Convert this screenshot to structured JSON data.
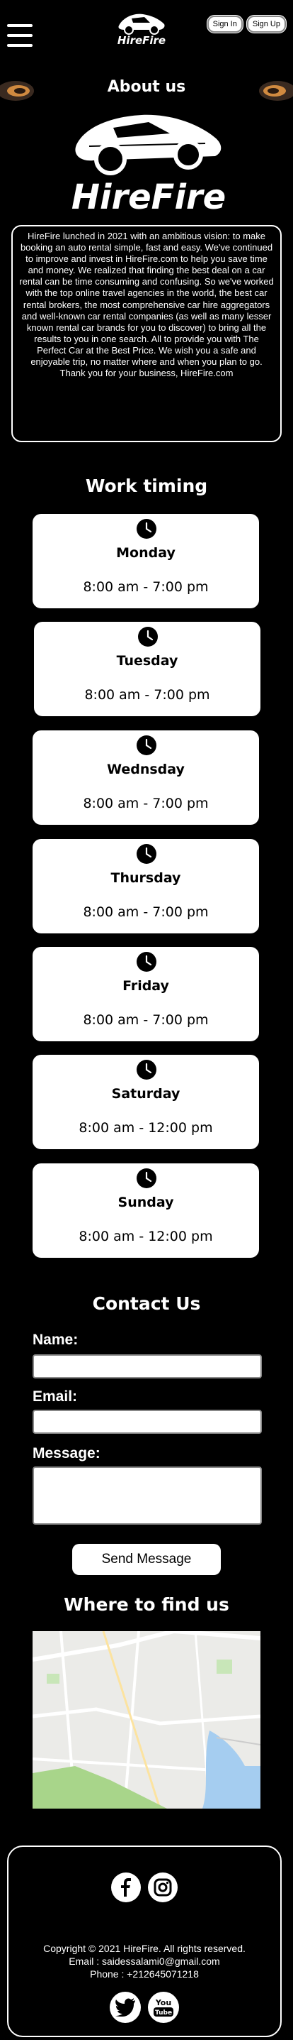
{
  "header": {
    "sign_in": "Sign In",
    "sign_up": "Sign Up"
  },
  "about": {
    "title": "About us",
    "logo_text": "HireFire",
    "paragraph": "HireFire lunched in 2021 with an ambitious vision: to make booking an auto rental simple, fast and easy. We've continued to improve and invest in HireFire.com to help you save time and money. We realized that finding the best deal on a car rental can be time consuming and confusing. So we've worked with the top online travel agencies in the world, the best car rental brokers, the most comprehensive car hire aggregators and well-known car rental  companies (as well as many lesser known rental car brands for you to discover) to bring all the results to you in one search. All to provide you with The Perfect Car at the Best Price. We wish you a safe and enjoyable trip, no matter where and when you plan to go. Thank you for your business, HireFire.com"
  },
  "work_timing": {
    "title": "Work timing",
    "days": [
      {
        "day": "Monday",
        "hours": "8:00 am  -  7:00 pm"
      },
      {
        "day": "Tuesday",
        "hours": "8:00 am  -  7:00 pm"
      },
      {
        "day": "Wednsday",
        "hours": "8:00 am  -  7:00 pm"
      },
      {
        "day": "Thursday",
        "hours": "8:00 am  -  7:00 pm"
      },
      {
        "day": "Friday",
        "hours": "8:00 am  -  7:00 pm"
      },
      {
        "day": "Saturday",
        "hours": "8:00 am  -  12:00 pm"
      },
      {
        "day": "Sunday",
        "hours": "8:00 am  -  12:00 pm"
      }
    ]
  },
  "contact": {
    "title": "Contact Us",
    "name_label": "Name:",
    "email_label": "Email:",
    "message_label": "Message:",
    "send_label": "Send Message"
  },
  "location": {
    "title": "Where to find us"
  },
  "footer": {
    "copyright": "Copyright © 2021 HireFire. All rights reserved.",
    "email": "Email : saidessalami0@gmail.com",
    "phone": "Phone : +212645071218",
    "youtube_text_1": "You",
    "youtube_text_2": "Tube"
  },
  "icons": [
    "menu-icon",
    "clock-icon",
    "facebook-icon",
    "instagram-icon",
    "twitter-icon",
    "youtube-icon"
  ]
}
